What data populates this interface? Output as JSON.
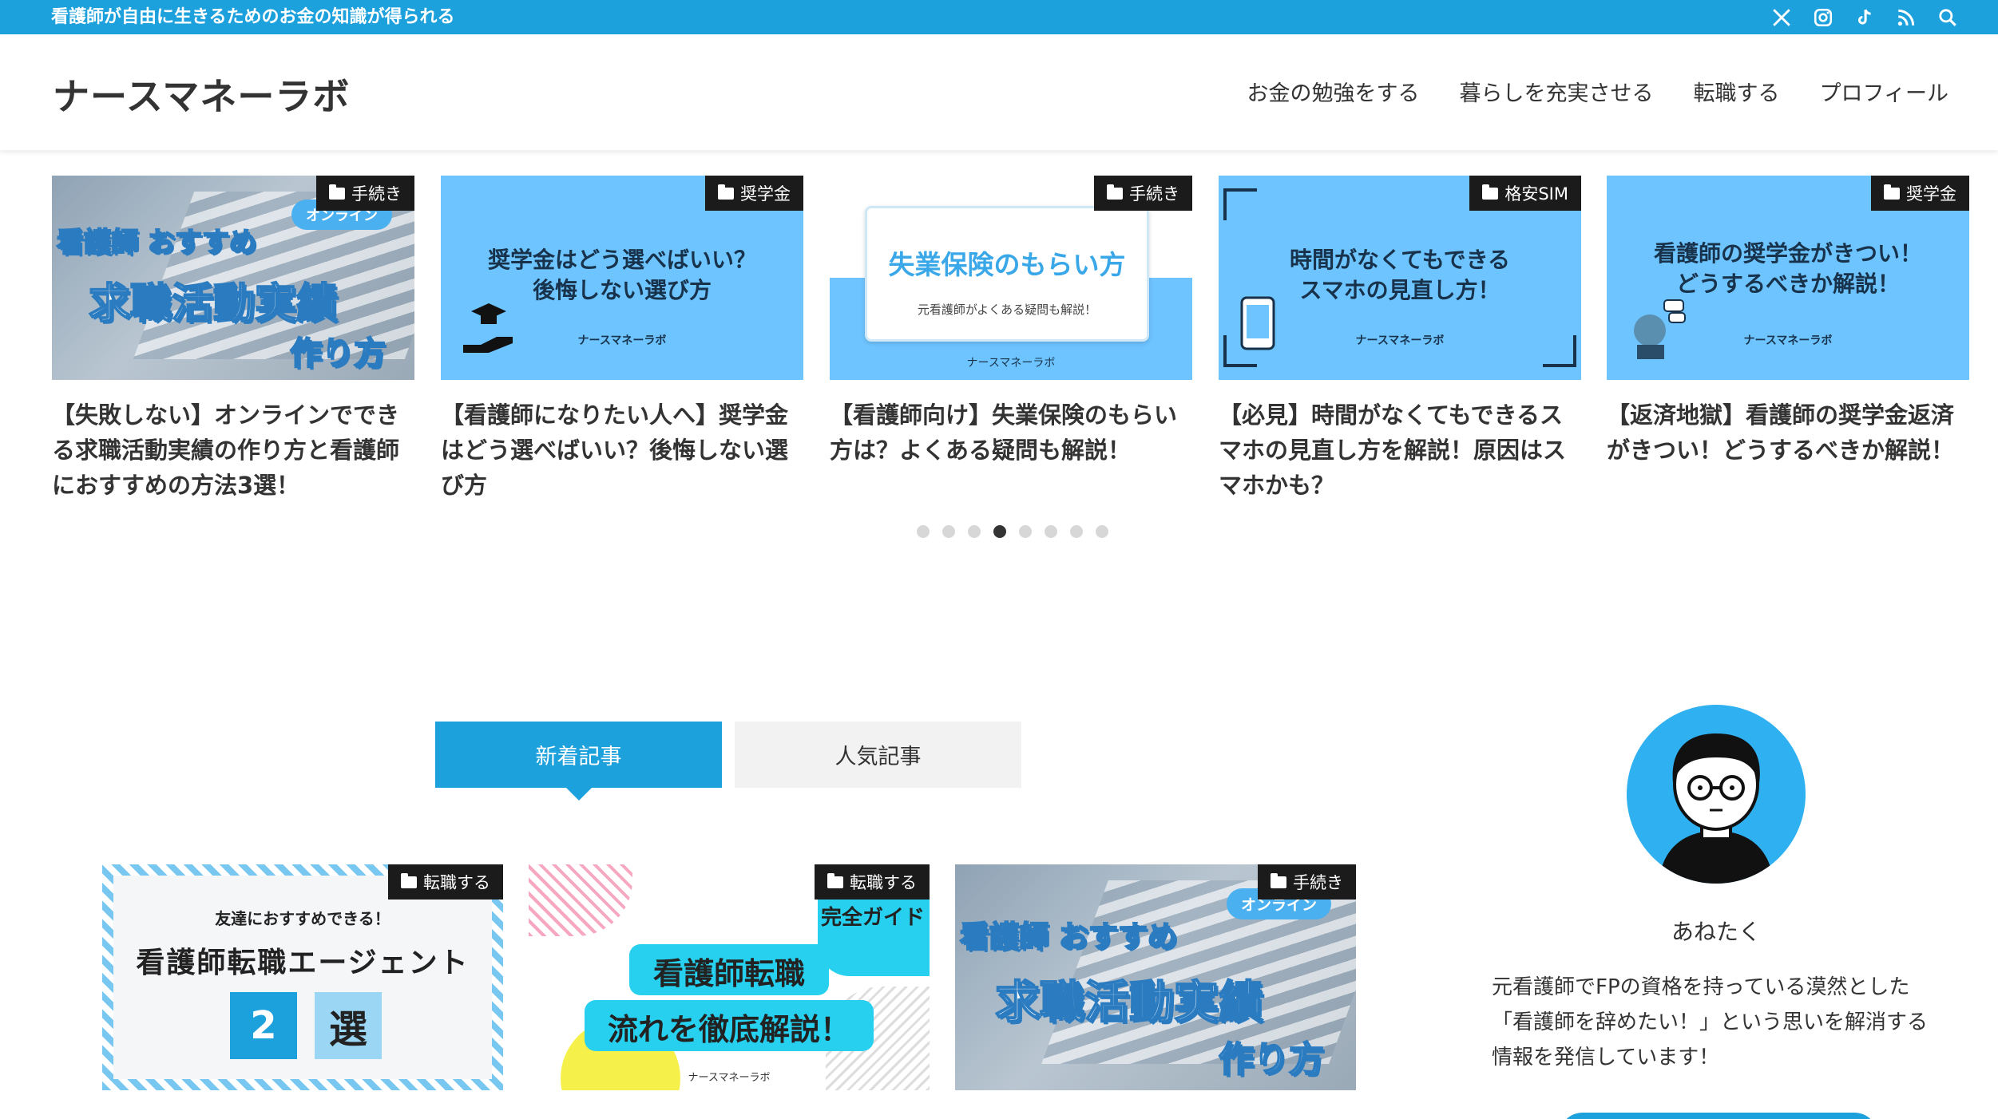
{
  "topbar": {
    "tagline": "看護師が自由に生きるためのお金の知識が得られる",
    "icons": [
      "x-icon",
      "instagram-icon",
      "tiktok-icon",
      "rss-icon",
      "search-icon"
    ]
  },
  "header": {
    "site_title": "ナースマネーラボ",
    "nav": [
      "お金の勉強をする",
      "暮らしを充実させる",
      "転職する",
      "プロフィール"
    ]
  },
  "carousel": {
    "items": [
      {
        "category": "手続き",
        "title": "【失敗しない】オンラインでできる求職活動実績の作り方と看護師におすすめの方法3選！",
        "thumb": {
          "line1": "看護師 おすすめ",
          "line2": "求職活動実績",
          "line3": "作り方",
          "bubble": "オンライン"
        }
      },
      {
        "category": "奨学金",
        "title": "【看護師になりたい人へ】奨学金はどう選べばいい？後悔しない選び方",
        "thumb": {
          "line1": "奨学金はどう選べばいい？",
          "line2": "後悔しない選び方",
          "brand": "ナースマネーラボ"
        }
      },
      {
        "category": "手続き",
        "title": "【看護師向け】失業保険のもらい方は？よくある疑問も解説！",
        "thumb": {
          "line1": "失業保険のもらい方",
          "line2": "元看護師がよくある疑問も解説！",
          "brand": "ナースマネーラボ"
        }
      },
      {
        "category": "格安SIM",
        "title": "【必見】時間がなくてもできるスマホの見直し方を解説！原因はスマホかも？",
        "thumb": {
          "line1": "時間がなくてもできる",
          "line2": "スマホの見直し方！",
          "brand": "ナースマネーラボ"
        }
      },
      {
        "category": "奨学金",
        "title": "【返済地獄】看護師の奨学金返済がきつい！どうするべきか解説！",
        "thumb": {
          "line1": "看護師の奨学金がきつい！",
          "line2": "どうするべきか解説！",
          "brand": "ナースマネーラボ"
        }
      }
    ],
    "dots_total": 8,
    "dots_active_index": 3
  },
  "tabs": {
    "new": "新着記事",
    "popular": "人気記事"
  },
  "list": {
    "items": [
      {
        "category": "転職する",
        "thumb": {
          "line1": "友達におすすめできる！",
          "line2": "看護師転職エージェント",
          "num": "2",
          "sen": "選"
        }
      },
      {
        "category": "転職する",
        "thumb": {
          "tag": "完全ガイド",
          "line1": "看護師転職",
          "line2": "流れを徹底解説！",
          "brand": "ナースマネーラボ"
        }
      },
      {
        "category": "手続き",
        "thumb": {
          "line1": "看護師 おすすめ",
          "line2": "求職活動実績",
          "line3": "作り方",
          "bubble": "オンライン"
        }
      }
    ]
  },
  "sidebar": {
    "author": "あねたく",
    "bio": "元看護師でFPの資格を持っている漠然とした「看護師を辞めたい！」という思いを解消する情報を発信しています！"
  },
  "colors": {
    "accent": "#1da1dc",
    "thumb_blue": "#6ec4ff",
    "dark": "#1b1b1b"
  }
}
